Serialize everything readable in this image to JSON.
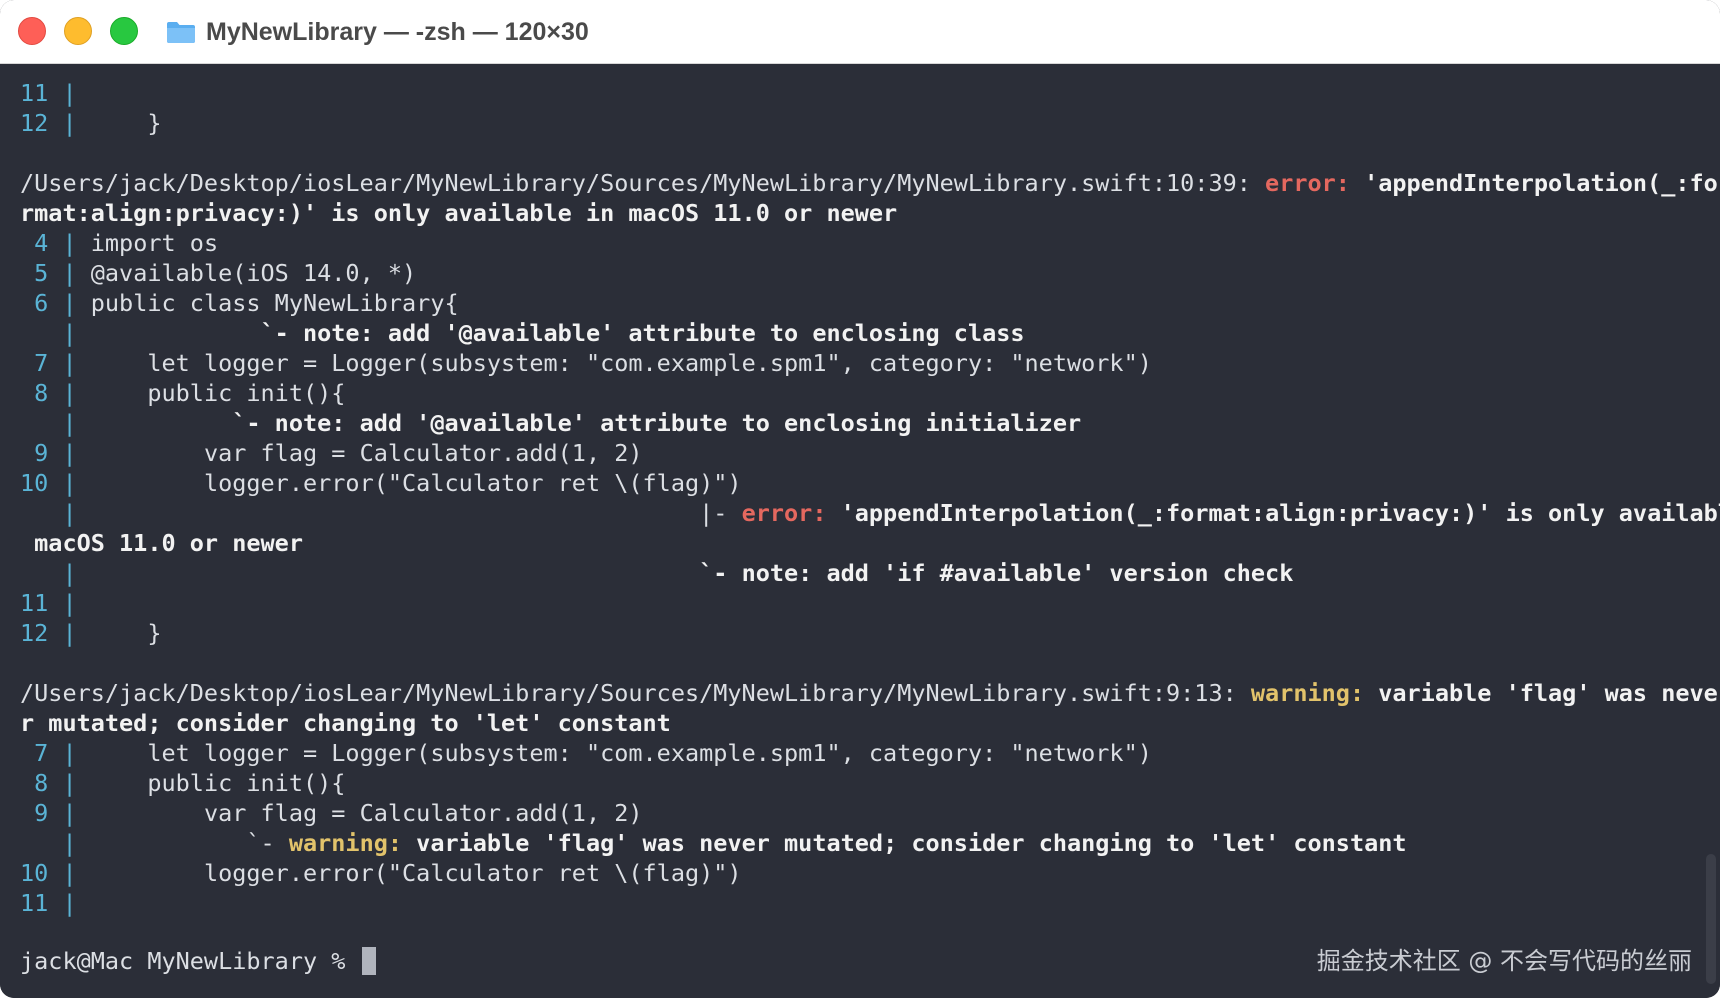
{
  "window": {
    "title": "MyNewLibrary — -zsh — 120×30",
    "folder_icon": "folder-icon"
  },
  "colors": {
    "background": "#2b2e38",
    "text": "#dcdfe4",
    "line_number": "#5ab4d6",
    "error": "#e4685f",
    "warning": "#e2c36b"
  },
  "terminal": {
    "lines": [
      [
        {
          "t": "11 ",
          "c": "ln"
        },
        {
          "t": "|",
          "c": "bar"
        }
      ],
      [
        {
          "t": "12 ",
          "c": "ln"
        },
        {
          "t": "|",
          "c": "bar"
        },
        {
          "t": "     }",
          "c": ""
        }
      ],
      [],
      [
        {
          "t": "/Users/jack/Desktop/iosLear/MyNewLibrary/Sources/MyNewLibrary/MyNewLibrary.swift:10:39: ",
          "c": ""
        },
        {
          "t": "error:",
          "c": "err"
        },
        {
          "t": " 'appendInterpolation(_:fo",
          "c": "b"
        }
      ],
      [
        {
          "t": "rmat:align:privacy:)' is only available in macOS 11.0 or newer",
          "c": "b"
        }
      ],
      [
        {
          "t": " 4 ",
          "c": "ln"
        },
        {
          "t": "|",
          "c": "bar"
        },
        {
          "t": " import os",
          "c": ""
        }
      ],
      [
        {
          "t": " 5 ",
          "c": "ln"
        },
        {
          "t": "|",
          "c": "bar"
        },
        {
          "t": " @available(iOS 14.0, *)",
          "c": ""
        }
      ],
      [
        {
          "t": " 6 ",
          "c": "ln"
        },
        {
          "t": "|",
          "c": "bar"
        },
        {
          "t": " public class MyNewLibrary{",
          "c": ""
        }
      ],
      [
        {
          "t": "   ",
          "c": "ln"
        },
        {
          "t": "|",
          "c": "bar"
        },
        {
          "t": "             `- note: add '@available' attribute to enclosing class",
          "c": "b"
        }
      ],
      [
        {
          "t": " 7 ",
          "c": "ln"
        },
        {
          "t": "|",
          "c": "bar"
        },
        {
          "t": "     let logger = Logger(subsystem: \"com.example.spm1\", category: \"network\")",
          "c": ""
        }
      ],
      [
        {
          "t": " 8 ",
          "c": "ln"
        },
        {
          "t": "|",
          "c": "bar"
        },
        {
          "t": "     public init(){",
          "c": ""
        }
      ],
      [
        {
          "t": "   ",
          "c": "ln"
        },
        {
          "t": "|",
          "c": "bar"
        },
        {
          "t": "           `- note: add '@available' attribute to enclosing initializer",
          "c": "b"
        }
      ],
      [
        {
          "t": " 9 ",
          "c": "ln"
        },
        {
          "t": "|",
          "c": "bar"
        },
        {
          "t": "         var flag = Calculator.add(1, 2)",
          "c": ""
        }
      ],
      [
        {
          "t": "10 ",
          "c": "ln"
        },
        {
          "t": "|",
          "c": "bar"
        },
        {
          "t": "         logger.error(\"Calculator ret \\(flag)\")",
          "c": ""
        }
      ],
      [
        {
          "t": "   ",
          "c": "ln"
        },
        {
          "t": "|",
          "c": "bar"
        },
        {
          "t": "                                            |- ",
          "c": ""
        },
        {
          "t": "error:",
          "c": "err"
        },
        {
          "t": " 'appendInterpolation(_:format:align:privacy:)' is only available in",
          "c": "b"
        }
      ],
      [
        {
          "t": " macOS 11.0 or newer",
          "c": "b"
        }
      ],
      [
        {
          "t": "   ",
          "c": "ln"
        },
        {
          "t": "|",
          "c": "bar"
        },
        {
          "t": "                                            `- note: add 'if #available' version check",
          "c": "b"
        }
      ],
      [
        {
          "t": "11 ",
          "c": "ln"
        },
        {
          "t": "|",
          "c": "bar"
        }
      ],
      [
        {
          "t": "12 ",
          "c": "ln"
        },
        {
          "t": "|",
          "c": "bar"
        },
        {
          "t": "     }",
          "c": ""
        }
      ],
      [],
      [
        {
          "t": "/Users/jack/Desktop/iosLear/MyNewLibrary/Sources/MyNewLibrary/MyNewLibrary.swift:9:13: ",
          "c": ""
        },
        {
          "t": "warning:",
          "c": "warn"
        },
        {
          "t": " variable 'flag' was neve",
          "c": "b"
        }
      ],
      [
        {
          "t": "r mutated; consider changing to 'let' constant",
          "c": "b"
        }
      ],
      [
        {
          "t": " 7 ",
          "c": "ln"
        },
        {
          "t": "|",
          "c": "bar"
        },
        {
          "t": "     let logger = Logger(subsystem: \"com.example.spm1\", category: \"network\")",
          "c": ""
        }
      ],
      [
        {
          "t": " 8 ",
          "c": "ln"
        },
        {
          "t": "|",
          "c": "bar"
        },
        {
          "t": "     public init(){",
          "c": ""
        }
      ],
      [
        {
          "t": " 9 ",
          "c": "ln"
        },
        {
          "t": "|",
          "c": "bar"
        },
        {
          "t": "         var flag = Calculator.add(1, 2)",
          "c": ""
        }
      ],
      [
        {
          "t": "   ",
          "c": "ln"
        },
        {
          "t": "|",
          "c": "bar"
        },
        {
          "t": "            `- ",
          "c": ""
        },
        {
          "t": "warning:",
          "c": "warn"
        },
        {
          "t": " variable 'flag' was never mutated; consider changing to 'let' constant",
          "c": "b"
        }
      ],
      [
        {
          "t": "10 ",
          "c": "ln"
        },
        {
          "t": "|",
          "c": "bar"
        },
        {
          "t": "         logger.error(\"Calculator ret \\(flag)\")",
          "c": ""
        }
      ],
      [
        {
          "t": "11 ",
          "c": "ln"
        },
        {
          "t": "|",
          "c": "bar"
        }
      ]
    ],
    "prompt": "jack@Mac MyNewLibrary % "
  },
  "watermark": "掘金技术社区 @ 不会写代码的丝丽"
}
